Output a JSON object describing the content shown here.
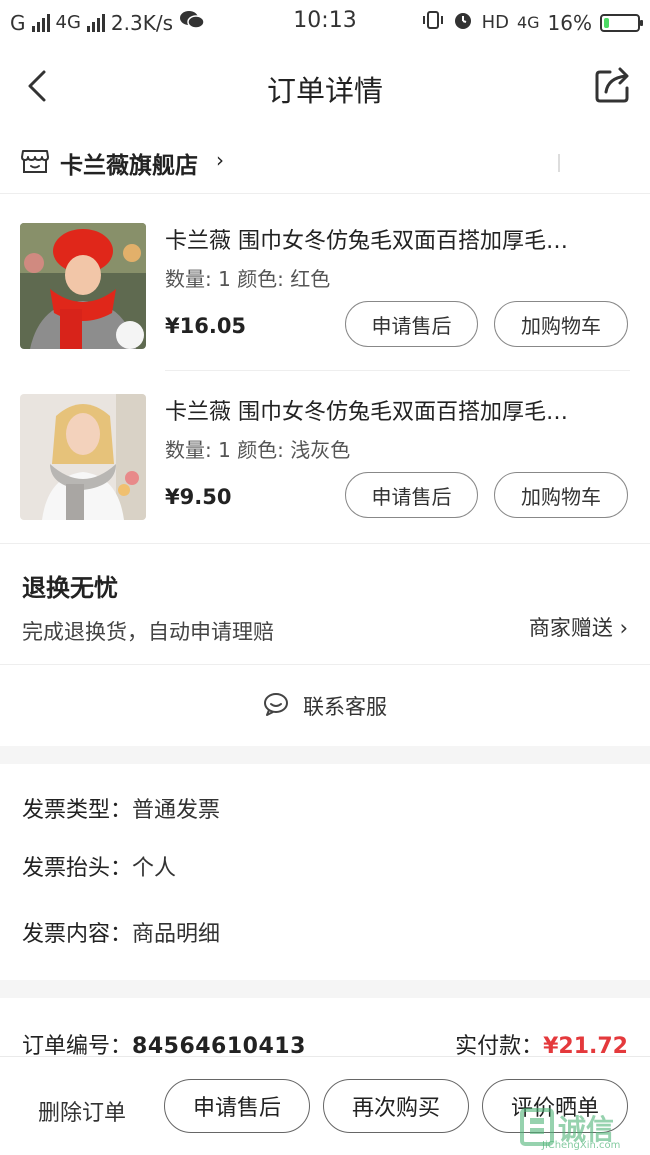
{
  "status_bar": {
    "carrier1": "G",
    "carrier2": "4G",
    "speed": "2.3K/s",
    "time": "10:13",
    "hd": "HD",
    "net": "4G",
    "battery": "16%",
    "battery_level": 0.16
  },
  "header": {
    "title": "订单详情",
    "back_icon": "back-arrow-icon",
    "share_icon": "share-icon"
  },
  "store": {
    "name": "卡兰薇旗舰店",
    "arrow": "›"
  },
  "products": [
    {
      "title": "卡兰薇 围巾女冬仿兔毛双面百搭加厚毛…",
      "qty_label": "数量: 1",
      "color_label": "颜色: 红色",
      "price": "¥16.05",
      "after_sale": "申请售后",
      "add_cart": "加购物车"
    },
    {
      "title": "卡兰薇 围巾女冬仿兔毛双面百搭加厚毛…",
      "qty_label": "数量: 1",
      "color_label": "颜色: 浅灰色",
      "price": "¥9.50",
      "after_sale": "申请售后",
      "add_cart": "加购物车"
    }
  ],
  "guarantee": {
    "title": "退换无忧",
    "subtitle": "完成退换货，自动申请理赔",
    "right": "商家赠送 ›"
  },
  "service": {
    "label": "联系客服"
  },
  "invoice": {
    "type_key": "发票类型：",
    "type_val": "普通发票",
    "head_key": "发票抬头：",
    "head_val": "个人",
    "content_key": "发票内容：",
    "content_val": "商品明细"
  },
  "order": {
    "no_key": "订单编号：",
    "no_val": "84564610413",
    "paid_key": "实付款：",
    "paid_val": "¥21.72"
  },
  "bottom": {
    "delete": "删除订单",
    "after_sale": "申请售后",
    "rebuy": "再次购买",
    "review": "评价晒单"
  },
  "watermark": {
    "text": "诚信",
    "sub": "JiChengXin.com"
  },
  "colors": {
    "price_red": "#e4393c",
    "battery_green": "#4cd964"
  }
}
